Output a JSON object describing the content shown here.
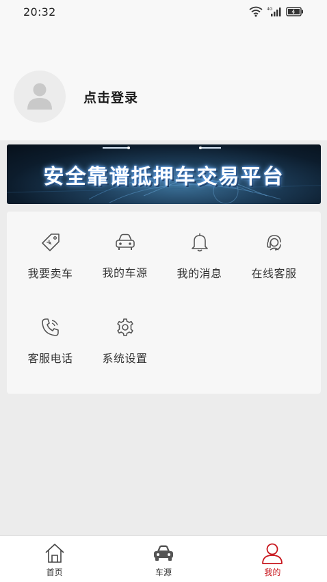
{
  "status_bar": {
    "time": "20:32",
    "icons": [
      "wifi-icon",
      "4g-signal-icon",
      "battery-icon"
    ]
  },
  "profile": {
    "login_label": "点击登录",
    "avatar_icon": "user-placeholder-icon"
  },
  "banner": {
    "text": "安全靠谱抵押车交易平台"
  },
  "menu": {
    "items": [
      {
        "label": "我要卖车",
        "icon": "price-tag-icon"
      },
      {
        "label": "我的车源",
        "icon": "car-icon"
      },
      {
        "label": "我的消息",
        "icon": "bell-icon"
      },
      {
        "label": "在线客服",
        "icon": "customer-service-icon"
      },
      {
        "label": "客服电话",
        "icon": "phone-icon"
      },
      {
        "label": "系统设置",
        "icon": "gear-icon"
      }
    ]
  },
  "bottom_nav": {
    "items": [
      {
        "label": "首页",
        "icon": "home-icon",
        "active": false
      },
      {
        "label": "车源",
        "icon": "car-icon",
        "active": false
      },
      {
        "label": "我的",
        "icon": "user-icon",
        "active": true
      }
    ],
    "active_color": "#c8161d"
  },
  "colors": {
    "accent": "#c8161d",
    "icon_gray": "#555555",
    "background": "#ececec"
  }
}
